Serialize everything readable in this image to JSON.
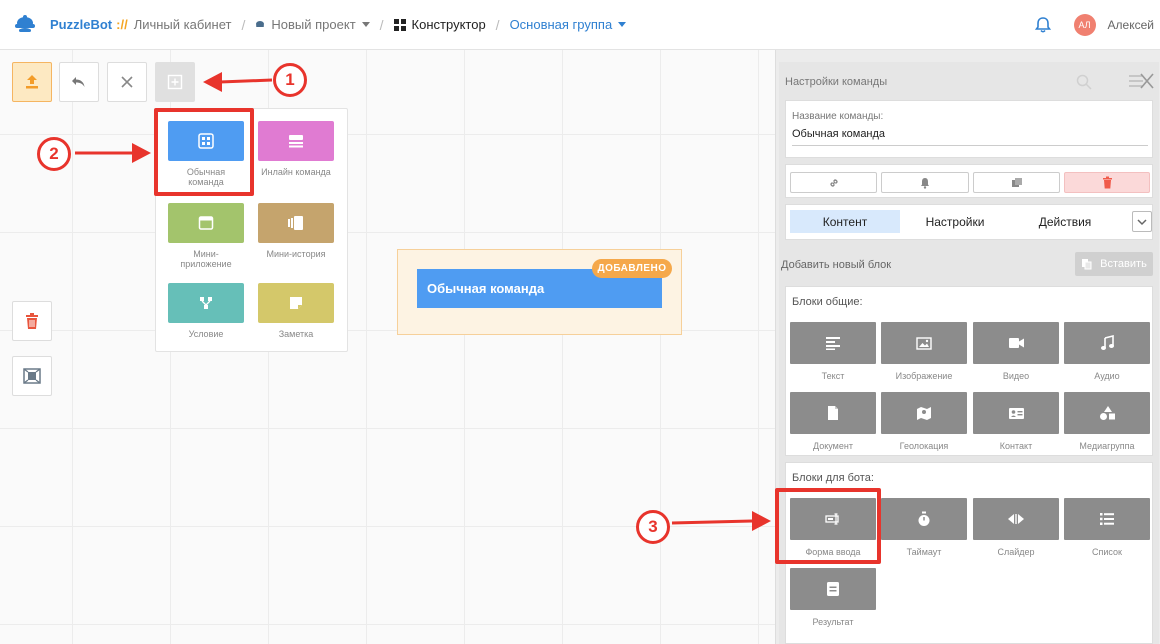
{
  "header": {
    "brand": "PuzzleBot",
    "brand_sep": "://",
    "crumbs": {
      "cabinet": "Личный кабинет",
      "project": "Новый проект",
      "constructor": "Конструктор",
      "group": "Основная группа"
    },
    "user": {
      "initials": "АЛ",
      "name": "Алексей"
    }
  },
  "toolbar": {
    "upload_icon": "upload-icon",
    "undo_icon": "undo-icon",
    "close_icon": "close-icon",
    "add_icon": "add-block-icon"
  },
  "dropdown": {
    "items": [
      {
        "label": "Обычная команда",
        "color": "#4f9cf2",
        "icon": "grid-icon"
      },
      {
        "label": "Инлайн команда",
        "color": "#e07bd2",
        "icon": "inline-icon"
      },
      {
        "label": "Мини-приложение",
        "color": "#a3c46c",
        "icon": "window-icon"
      },
      {
        "label": "Мини-история",
        "color": "#c5a46d",
        "icon": "stories-icon"
      },
      {
        "label": "Условие",
        "color": "#66bfb8",
        "icon": "branch-icon"
      },
      {
        "label": "Заметка",
        "color": "#d4c86a",
        "icon": "note-icon"
      }
    ]
  },
  "node": {
    "title": "Обычная команда",
    "badge": "ДОБАВЛЕНО"
  },
  "panel": {
    "title": "Настройки команды",
    "name_label": "Название команды:",
    "name_value": "Обычная команда",
    "tabs": [
      "Контент",
      "Настройки",
      "Действия"
    ],
    "add_block_label": "Добавить новый блок",
    "paste_label": "Вставить",
    "common_title": "Блоки общие:",
    "common_blocks": [
      "Текст",
      "Изображение",
      "Видео",
      "Аудио",
      "Документ",
      "Геолокация",
      "Контакт",
      "Медиагруппа"
    ],
    "bot_title": "Блоки для бота:",
    "bot_blocks": [
      "Форма ввода",
      "Таймаут",
      "Слайдер",
      "Список",
      "Результат"
    ]
  },
  "annotations": [
    "1",
    "2",
    "3"
  ],
  "colors": {
    "accent": "#2f80d1",
    "annotation": "#e8342c",
    "badge": "#f5a84a",
    "node": "#4f9cf2"
  }
}
